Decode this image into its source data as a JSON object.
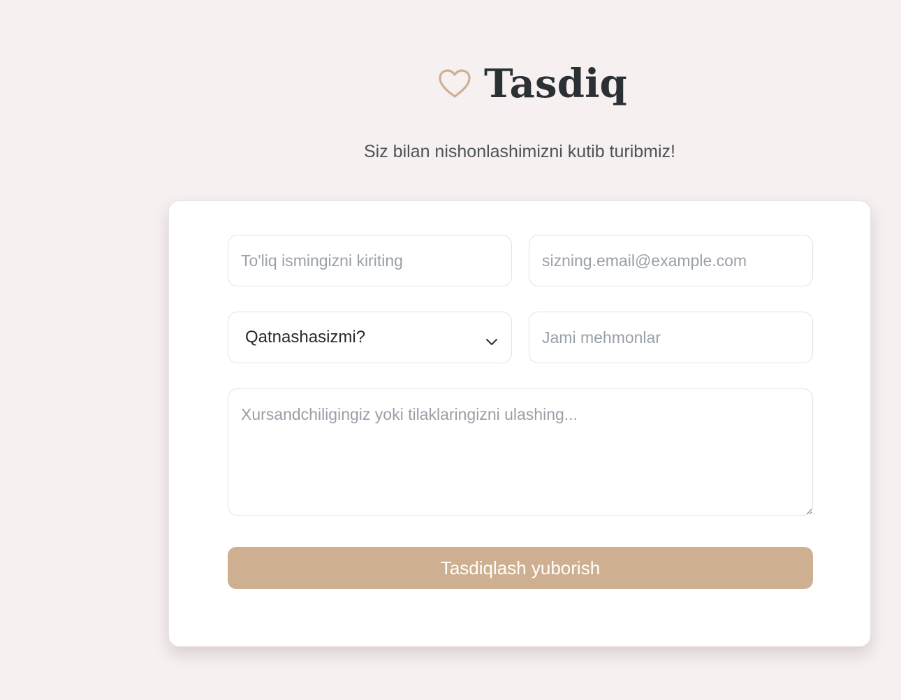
{
  "header": {
    "brand_icon": "heart-outline-icon",
    "title": "Tasdiq",
    "subtitle": "Siz bilan nishonlashimizni kutib turibmiz!"
  },
  "form": {
    "name": {
      "value": "",
      "placeholder": "To'liq ismingizni kiriting"
    },
    "email": {
      "value": "",
      "placeholder": "sizning.email@example.com"
    },
    "attendance": {
      "selected_label": "Qatnashasizmi?",
      "icon": "chevron-down-icon"
    },
    "guests": {
      "value": "",
      "placeholder": "Jami mehmonlar"
    },
    "message": {
      "value": "",
      "placeholder": "Xursandchiligingiz yoki tilaklaringizni ulashing..."
    },
    "submit_label": "Tasdiqlash yuborish"
  },
  "colors": {
    "page_background": "#f6f0f0",
    "card_background": "#ffffff",
    "accent": "#ceb091",
    "title_text": "#2b3035",
    "placeholder_text": "#9aa0a8"
  }
}
